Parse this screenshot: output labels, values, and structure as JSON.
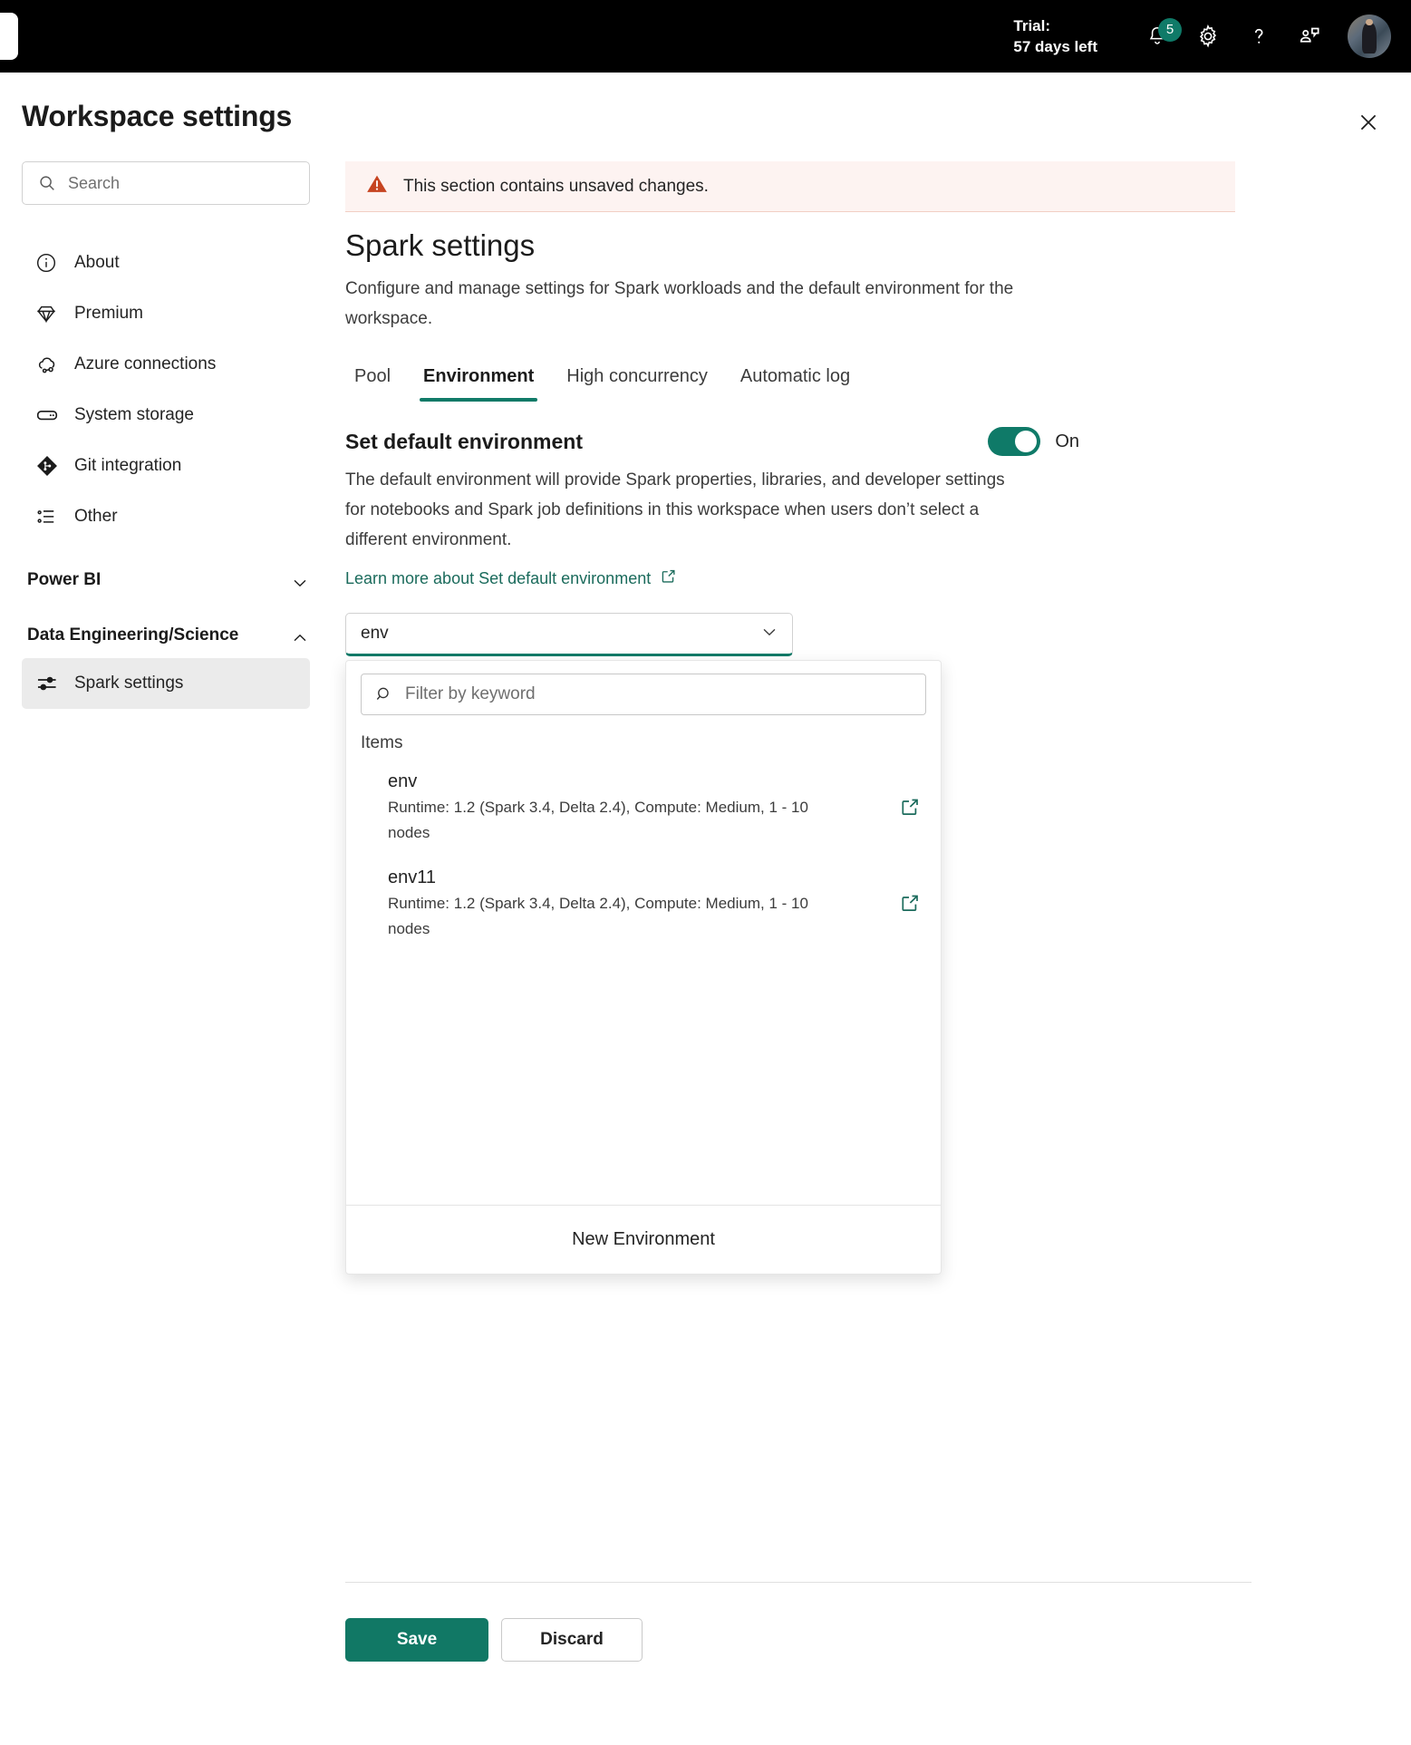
{
  "topbar": {
    "trial_line1": "Trial:",
    "trial_line2": "57 days left",
    "notification_badge": "5",
    "icons": [
      "bell-icon",
      "gear-icon",
      "question-icon",
      "feedback-icon",
      "avatar"
    ]
  },
  "header": {
    "title": "Workspace settings",
    "close_label": "Close"
  },
  "sidebar": {
    "search_placeholder": "Search",
    "search_value": "",
    "items": [
      {
        "label": "About",
        "icon": "info-icon"
      },
      {
        "label": "Premium",
        "icon": "diamond-icon"
      },
      {
        "label": "Azure connections",
        "icon": "cloud-link-icon"
      },
      {
        "label": "System storage",
        "icon": "storage-icon"
      },
      {
        "label": "Git integration",
        "icon": "git-icon"
      },
      {
        "label": "Other",
        "icon": "list-icon"
      }
    ],
    "groups": [
      {
        "label": "Power BI",
        "expanded": false,
        "chevron": "chevron-down-icon",
        "children": []
      },
      {
        "label": "Data Engineering/Science",
        "expanded": true,
        "chevron": "chevron-up-icon",
        "children": [
          {
            "label": "Spark settings",
            "icon": "sliders-icon",
            "selected": true
          }
        ]
      }
    ]
  },
  "main": {
    "warning": "This section contains unsaved changes.",
    "section_title": "Spark settings",
    "section_desc": "Configure and manage settings for Spark workloads and the default environment for the workspace.",
    "tabs": [
      {
        "label": "Pool",
        "active": false
      },
      {
        "label": "Environment",
        "active": true
      },
      {
        "label": "High concurrency",
        "active": false
      },
      {
        "label": "Automatic log",
        "active": false
      }
    ],
    "setting": {
      "title": "Set default environment",
      "toggle_state": "On",
      "description": "The default environment will provide Spark properties, libraries, and developer settings for notebooks and Spark job definitions in this workspace when users don’t select a different environment.",
      "learn_more": "Learn more about Set default environment"
    },
    "combobox": {
      "value": "env",
      "chevron": "chevron-down-icon",
      "expanded": true
    },
    "dropdown": {
      "filter_placeholder": "Filter by keyword",
      "filter_value": "",
      "group_label": "Items",
      "items": [
        {
          "name": "env",
          "meta": "Runtime: 1.2 (Spark 3.4, Delta 2.4), Compute: Medium, 1 - 10 nodes",
          "open_icon": "external-link-icon"
        },
        {
          "name": "env11",
          "meta": "Runtime: 1.2 (Spark 3.4, Delta 2.4), Compute: Medium, 1 - 10 nodes",
          "open_icon": "external-link-icon"
        }
      ],
      "footer_action": "New Environment"
    }
  },
  "footer": {
    "save_label": "Save",
    "discard_label": "Discard"
  },
  "colors": {
    "accent_teal": "#0f7a68",
    "primary_button": "#117865",
    "link_teal": "#1b6b5c",
    "warning_bg": "#fdf3f1",
    "warning_icon": "#c64421",
    "topbar_bg": "#000000",
    "selected_nav_bg": "#ebebeb"
  }
}
